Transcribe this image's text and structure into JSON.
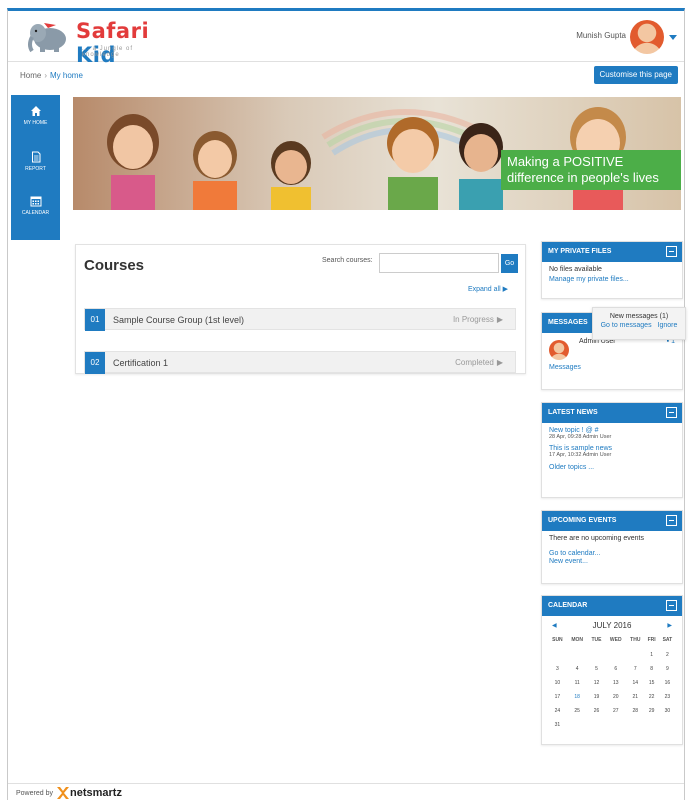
{
  "header": {
    "logo_text_1": "Safari",
    "logo_text_2": "Kid",
    "logo_tagline": "... a Jungle of knowledge",
    "user_name": "Munish Gupta"
  },
  "breadcrumb": {
    "home": "Home",
    "separator": "›",
    "current": "My home"
  },
  "customise_button": "Customise this page",
  "sidenav": [
    {
      "label": "MY HOME",
      "icon": "home-icon"
    },
    {
      "label": "REPORT",
      "icon": "report-icon"
    },
    {
      "label": "CALENDAR",
      "icon": "calendar-icon"
    }
  ],
  "banner": {
    "caption": "Making a POSITIVE difference in people's lives"
  },
  "courses": {
    "title": "Courses",
    "search_label": "Search courses:",
    "go_label": "Go",
    "expand_all": "Expand all",
    "items": [
      {
        "num": "01",
        "name": "Sample Course Group (1st level)",
        "status": "In Progress"
      },
      {
        "num": "02",
        "name": "Certification 1",
        "status": "Completed"
      }
    ]
  },
  "private_files": {
    "title": "MY PRIVATE FILES",
    "empty": "No files available",
    "manage": "Manage my private files..."
  },
  "messages": {
    "title": "MESSAGES",
    "popup_title": "New messages (1)",
    "popup_go": "Go to messages",
    "popup_ignore": "Ignore",
    "user": "Admin User",
    "count": "1",
    "link": "Messages"
  },
  "latest_news": {
    "title": "LATEST NEWS",
    "items": [
      {
        "title": "New topic ! @ #",
        "meta": "28 Apr, 09:28  Admin User"
      },
      {
        "title": "This is sample news",
        "meta": "17 Apr, 10:32  Admin User"
      }
    ],
    "older": "Older topics ..."
  },
  "upcoming_events": {
    "title": "UPCOMING EVENTS",
    "empty": "There are no upcoming events",
    "go_calendar": "Go to calendar...",
    "new_event": "New event..."
  },
  "calendar": {
    "title": "CALENDAR",
    "month": "JULY 2016",
    "days": [
      "SUN",
      "MON",
      "TUE",
      "WED",
      "THU",
      "FRI",
      "SAT"
    ],
    "weeks": [
      [
        "",
        "",
        "",
        "",
        "",
        "1",
        "2"
      ],
      [
        "3",
        "4",
        "5",
        "6",
        "7",
        "8",
        "9"
      ],
      [
        "10",
        "11",
        "12",
        "13",
        "14",
        "15",
        "16"
      ],
      [
        "17",
        "18",
        "19",
        "20",
        "21",
        "22",
        "23"
      ],
      [
        "24",
        "25",
        "26",
        "27",
        "28",
        "29",
        "30"
      ],
      [
        "31",
        "",
        "",
        "",
        "",
        "",
        ""
      ]
    ],
    "today": "18"
  },
  "footer": {
    "powered_by": "Powered by",
    "brand": "netsmartz"
  },
  "colors": {
    "primary": "#1f7bc1",
    "banner_green": "#4cae48",
    "logo_red": "#e23b3b"
  }
}
